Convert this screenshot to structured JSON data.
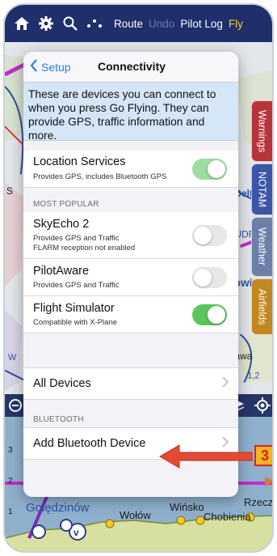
{
  "toolbar": {
    "route": "Route",
    "undo": "Undo",
    "pilot_log": "Pilot Log",
    "fly": "Fly"
  },
  "side_tabs": {
    "warnings": "Warnings",
    "notam": "NOTAM",
    "weather": "Weather",
    "airfields": "Airfields"
  },
  "popover": {
    "back_label": "Setup",
    "title": "Connectivity",
    "info": "These are devices you can connect to when you press Go Flying. They can provide GPS, traffic information and more.",
    "location": {
      "title": "Location Services",
      "subtitle": "Provides GPS, includes Bluetooth GPS",
      "enabled": true
    },
    "most_popular_header": "MOST POPULAR",
    "devices": [
      {
        "title": "SkyEcho 2",
        "subtitle1": "Provides GPS and Traffic",
        "subtitle2": "FLARM reception not enabled",
        "enabled": false
      },
      {
        "title": "PilotAware",
        "subtitle1": "Provides GPS and Traffic",
        "enabled": false
      },
      {
        "title": "Flight Simulator",
        "subtitle1": "Compatible with X-Plane",
        "enabled": true
      }
    ],
    "all_devices": "All Devices",
    "bluetooth_header": "BLUETOOTH",
    "add_bluetooth": "Add Bluetooth Device"
  },
  "map_labels": {
    "delt": "Delt",
    "udf": "UDF",
    "owic": "owic",
    "awa": "awa",
    "num": "1,2",
    "s": "S",
    "w": "W",
    "rzecz": "Rzecz",
    "chobienia": "Chobienia",
    "winsko": "Wińsko",
    "wolow": "Wołów",
    "goledzinow": "Golędzinów"
  },
  "profile_ticks": [
    "3",
    "2",
    "1"
  ],
  "callout": {
    "number": "3"
  },
  "colors": {
    "toolbar_bg": "#1e2f6b",
    "accent_blue": "#2f7cf6",
    "toggle_on": "#5cc55e",
    "warnings_tab": "#b8343a",
    "notam_tab": "#3c55a6",
    "weather_tab": "#6d7fa8",
    "airfields_tab": "#c2871f",
    "callout_red": "#d8231f",
    "callout_badge": "#f0b522"
  }
}
